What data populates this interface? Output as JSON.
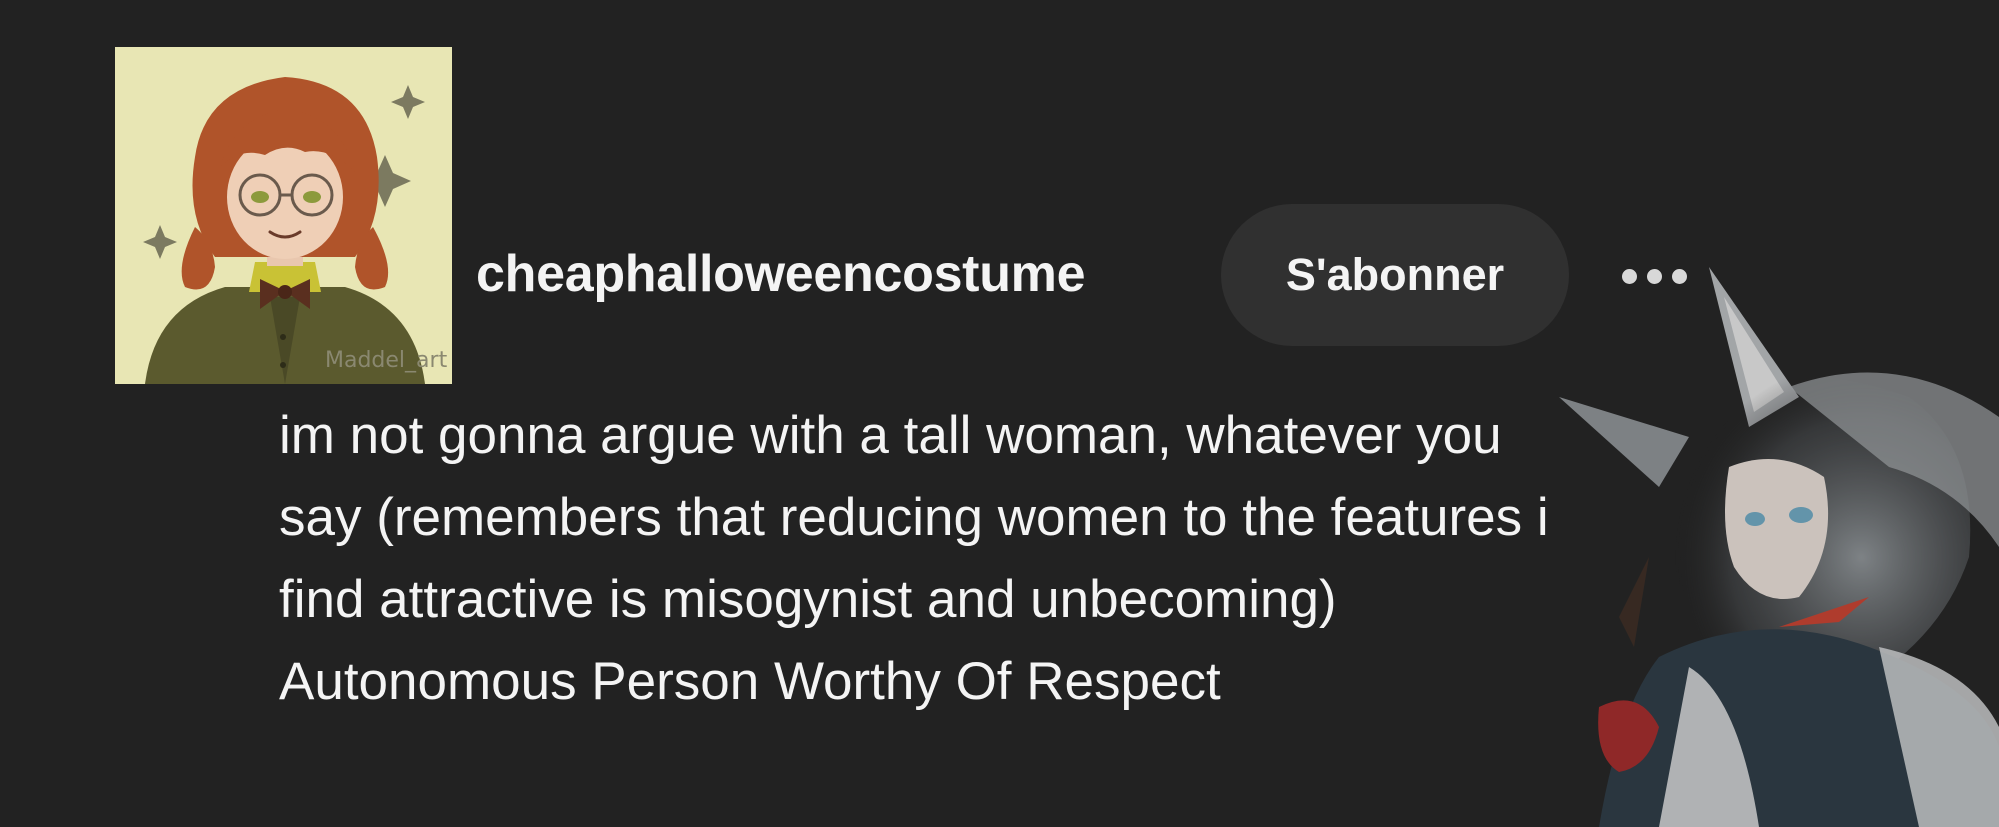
{
  "post": {
    "username": "cheaphalloweencostume",
    "follow_label": "S'abonner",
    "more_icon": "more-horizontal-icon",
    "avatar_signature": "Maddel_art",
    "body_lines": [
      "im not gonna argue with a tall woman, whatever you",
      "say (remembers that reducing women to the features i",
      "find attractive is misogynist and unbecoming)",
      "Autonomous Person Worthy Of Respect"
    ]
  },
  "colors": {
    "background": "#222222",
    "button_background": "#303030",
    "text": "#f4f4f4",
    "avatar_background": "#e8e6b4"
  }
}
